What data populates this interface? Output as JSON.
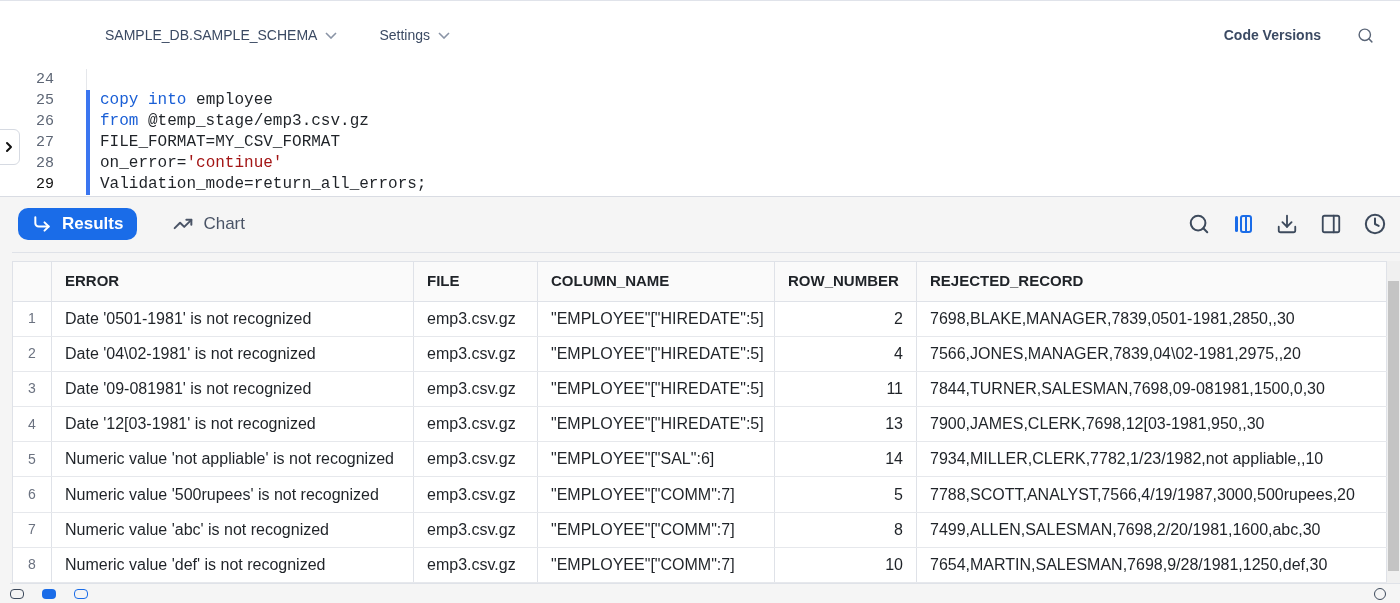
{
  "header": {
    "context": "SAMPLE_DB.SAMPLE_SCHEMA",
    "settings": "Settings",
    "code_versions": "Code Versions"
  },
  "editor": {
    "lines": [
      {
        "number": "24",
        "active": false
      },
      {
        "number": "25",
        "active": false,
        "segments": [
          {
            "kind": "keyword",
            "text": "copy into"
          },
          {
            "kind": "plain",
            "text": " employee"
          }
        ]
      },
      {
        "number": "26",
        "active": false,
        "segments": [
          {
            "kind": "keyword",
            "text": "from"
          },
          {
            "kind": "plain",
            "text": " @temp_stage/emp3.csv.gz"
          }
        ]
      },
      {
        "number": "27",
        "active": false,
        "segments": [
          {
            "kind": "plain",
            "text": "FILE_FORMAT=MY_CSV_FORMAT"
          }
        ]
      },
      {
        "number": "28",
        "active": false,
        "segments": [
          {
            "kind": "plain",
            "text": "on_error="
          },
          {
            "kind": "string",
            "text": "'continue'"
          }
        ]
      },
      {
        "number": "29",
        "active": true,
        "segments": [
          {
            "kind": "plain",
            "text": "Validation_mode=return_all_errors;"
          }
        ]
      }
    ]
  },
  "result_tabs": [
    {
      "label": "Results",
      "kind": "results",
      "selected": true
    },
    {
      "label": "Chart",
      "kind": "chart",
      "selected": false
    }
  ],
  "toolbar": [
    {
      "kind": "search",
      "selected": false
    },
    {
      "kind": "columns",
      "selected": true
    },
    {
      "kind": "download",
      "selected": false
    },
    {
      "kind": "panel",
      "selected": false
    },
    {
      "kind": "history",
      "selected": false
    }
  ],
  "table": {
    "columns": [
      "",
      "ERROR",
      "FILE",
      "COLUMN_NAME",
      "ROW_NUMBER",
      "REJECTED_RECORD"
    ],
    "rows": [
      [
        "1",
        "Date '0501-1981' is not recognized",
        "emp3.csv.gz",
        "\"EMPLOYEE\"[\"HIREDATE\":5]",
        "2",
        "7698,BLAKE,MANAGER,7839,0501-1981,2850,,30"
      ],
      [
        "2",
        "Date '04\\02-1981' is not recognized",
        "emp3.csv.gz",
        "\"EMPLOYEE\"[\"HIREDATE\":5]",
        "4",
        "7566,JONES,MANAGER,7839,04\\02-1981,2975,,20"
      ],
      [
        "3",
        "Date '09-081981' is not recognized",
        "emp3.csv.gz",
        "\"EMPLOYEE\"[\"HIREDATE\":5]",
        "11",
        "7844,TURNER,SALESMAN,7698,09-081981,1500,0,30"
      ],
      [
        "4",
        "Date '12[03-1981' is not recognized",
        "emp3.csv.gz",
        "\"EMPLOYEE\"[\"HIREDATE\":5]",
        "13",
        "7900,JAMES,CLERK,7698,12[03-1981,950,,30"
      ],
      [
        "5",
        "Numeric value 'not appliable' is not recognized",
        "emp3.csv.gz",
        "\"EMPLOYEE\"[\"SAL\":6]",
        "14",
        "7934,MILLER,CLERK,7782,1/23/1982,not appliable,,10"
      ],
      [
        "6",
        "Numeric value '500rupees' is not recognized",
        "emp3.csv.gz",
        "\"EMPLOYEE\"[\"COMM\":7]",
        "5",
        "7788,SCOTT,ANALYST,7566,4/19/1987,3000,500rupees,20"
      ],
      [
        "7",
        "Numeric value 'abc' is not recognized",
        "emp3.csv.gz",
        "\"EMPLOYEE\"[\"COMM\":7]",
        "8",
        "7499,ALLEN,SALESMAN,7698,2/20/1981,1600,abc,30"
      ],
      [
        "8",
        "Numeric value 'def' is not recognized",
        "emp3.csv.gz",
        "\"EMPLOYEE\"[\"COMM\":7]",
        "10",
        "7654,MARTIN,SALESMAN,7698,9/28/1981,1250,def,30"
      ]
    ]
  }
}
